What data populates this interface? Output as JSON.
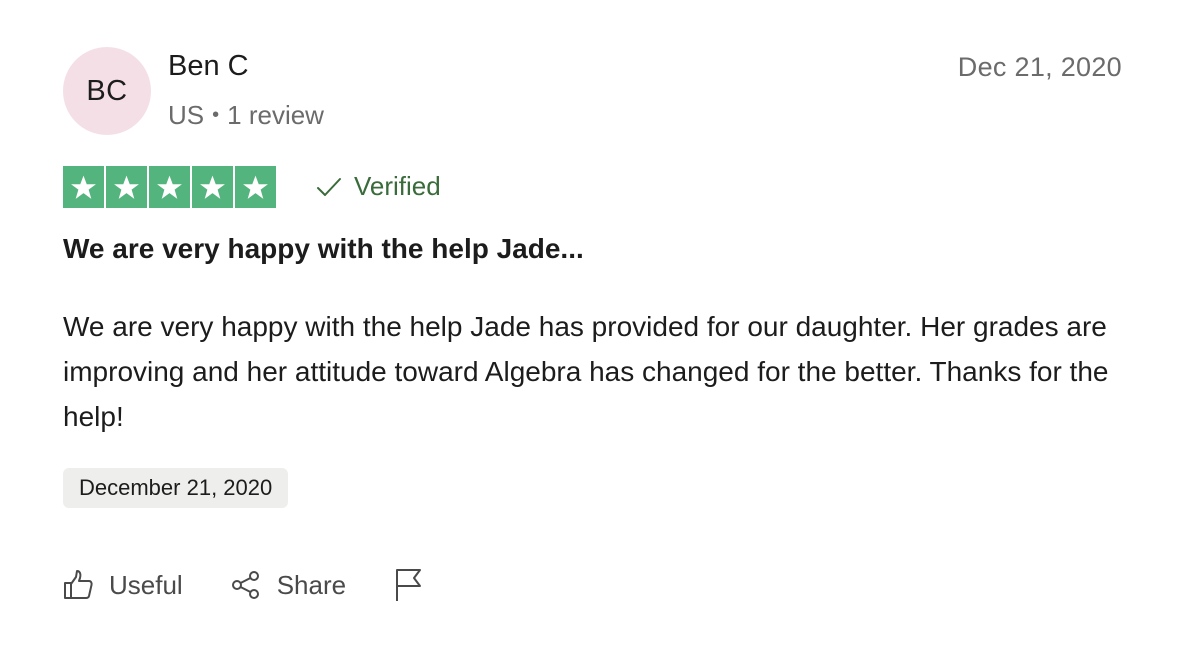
{
  "author": {
    "initials": "BC",
    "name": "Ben C",
    "country": "US",
    "reviews": "1 review",
    "avatar_color": "#f5dfe6"
  },
  "review": {
    "date_short": "Dec 21, 2020",
    "rating": 5,
    "rating_max": 5,
    "star_color": "#54b47d",
    "verified_label": "Verified",
    "title": "We are very happy with the help Jade...",
    "body": "We are very happy with the help Jade has provided for our daughter. Her grades are improving and her attitude toward Algebra has changed for the better. Thanks for the help!",
    "date_of_experience": "December 21, 2020"
  },
  "actions": {
    "useful_label": "Useful",
    "share_label": "Share",
    "icons": [
      "thumbs-up-icon",
      "share-icon",
      "flag-icon"
    ]
  }
}
